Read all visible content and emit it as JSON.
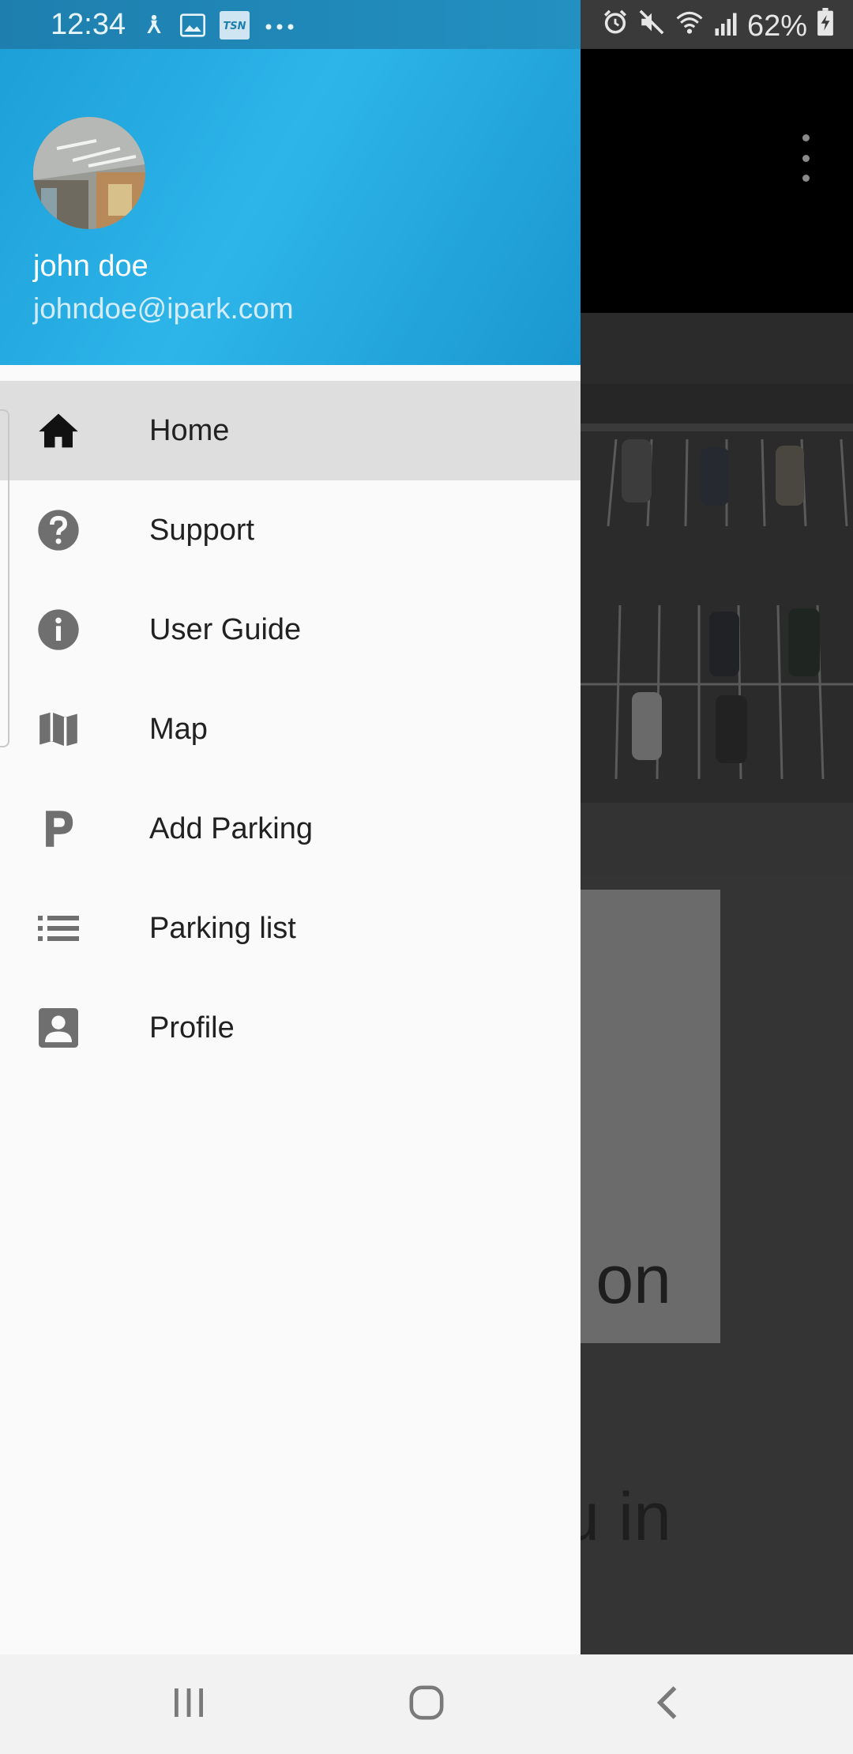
{
  "status_bar": {
    "time": "12:34",
    "battery": "62%",
    "left_icons": [
      "accessibility-icon",
      "gallery-icon",
      "tsn-app-icon",
      "more-notifications-icon"
    ],
    "right_icons": [
      "alarm-icon",
      "mute-icon",
      "wifi-icon",
      "signal-icon",
      "battery-charging-icon"
    ]
  },
  "background_app": {
    "card_text_line1": "on",
    "card_text_line2": "u in"
  },
  "drawer": {
    "user": {
      "name": "john doe",
      "email": "johndoe@ipark.com"
    },
    "items": [
      {
        "label": "Home",
        "icon": "home-icon",
        "active": true
      },
      {
        "label": "Support",
        "icon": "help-icon",
        "active": false
      },
      {
        "label": "User Guide",
        "icon": "info-icon",
        "active": false
      },
      {
        "label": "Map",
        "icon": "map-icon",
        "active": false
      },
      {
        "label": "Add Parking",
        "icon": "parking-icon",
        "active": false
      },
      {
        "label": "Parking list",
        "icon": "list-icon",
        "active": false
      },
      {
        "label": "Profile",
        "icon": "profile-icon",
        "active": false
      }
    ]
  },
  "colors": {
    "header_blue": "#2db5e9",
    "active_item_bg": "#dedede",
    "icon_gray": "#6f6f6f"
  },
  "nav_bar": {
    "buttons": [
      "recent-apps",
      "home",
      "back"
    ]
  }
}
